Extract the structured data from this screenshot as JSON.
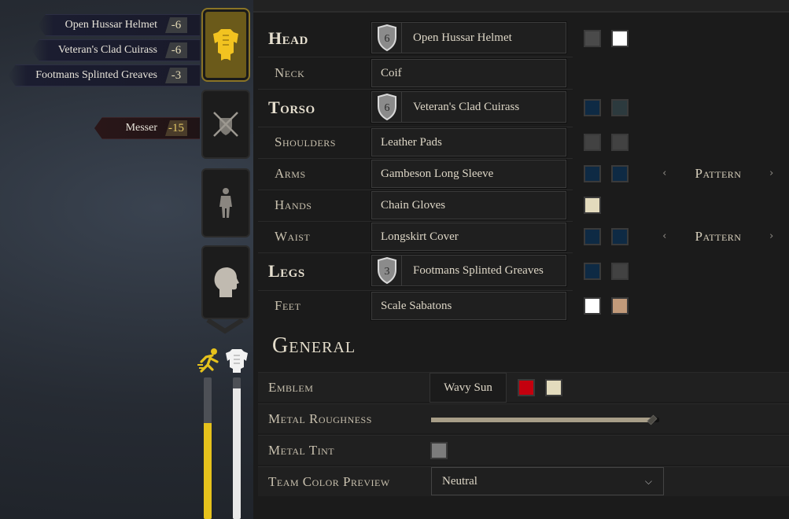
{
  "summary": {
    "items": [
      {
        "name": "Open Hussar Helmet",
        "cost": "-6"
      },
      {
        "name": "Veteran's Clad Cuirass",
        "cost": "-6"
      },
      {
        "name": "Footmans Splinted Greaves",
        "cost": "-3"
      }
    ],
    "weapon": {
      "name": "Messer",
      "cost": "-15"
    }
  },
  "tabs": [
    {
      "name": "armor-tab",
      "icon": "armor-icon",
      "active": true
    },
    {
      "name": "weapons-tab",
      "icon": "crossed-swords-shield-icon",
      "active": false
    },
    {
      "name": "body-tab",
      "icon": "body-figure-icon",
      "active": false
    },
    {
      "name": "head-tab",
      "icon": "head-profile-icon",
      "active": false
    }
  ],
  "stats": {
    "speed": {
      "icon": "running-man-icon",
      "level": 0.68,
      "color": "#e6c21c"
    },
    "armor": {
      "icon": "armor-white-icon",
      "level": 0.92,
      "color": "#e8e8e8"
    }
  },
  "slots": {
    "head": {
      "label": "Head",
      "item": "Open Hussar Helmet",
      "tier": "6",
      "colors": [
        "#4a4a4a",
        "#ffffff"
      ]
    },
    "neck": {
      "label": "Neck",
      "item": "Coif"
    },
    "torso": {
      "label": "Torso",
      "item": "Veteran's Clad Cuirass",
      "tier": "6",
      "colors": [
        "#0e2a44",
        "#2c3a3e"
      ]
    },
    "shoulders": {
      "label": "Shoulders",
      "item": "Leather Pads",
      "colors": [
        "#424242",
        "#424242"
      ]
    },
    "arms": {
      "label": "Arms",
      "item": "Gambeson Long Sleeve",
      "colors": [
        "#0e2a44",
        "#0e2a44"
      ],
      "pattern": "Pattern"
    },
    "hands": {
      "label": "Hands",
      "item": "Chain Gloves",
      "colors": [
        "#e3dbbd"
      ]
    },
    "waist": {
      "label": "Waist",
      "item": "Longskirt Cover",
      "colors": [
        "#0e2a44",
        "#0e2a44"
      ],
      "pattern": "Pattern"
    },
    "legs": {
      "label": "Legs",
      "item": "Footmans Splinted Greaves",
      "tier": "3",
      "colors": [
        "#0e2a44",
        "#424242"
      ]
    },
    "feet": {
      "label": "Feet",
      "item": "Scale Sabatons",
      "colors": [
        "#ffffff",
        "#c19a7a"
      ]
    }
  },
  "general": {
    "title": "General",
    "emblem": {
      "label": "Emblem",
      "value": "Wavy Sun",
      "colors": [
        "#c4000e",
        "#e3dbbd"
      ]
    },
    "roughness": {
      "label": "Metal Roughness",
      "level": 0.97
    },
    "tint": {
      "label": "Metal Tint",
      "color": "#7c7c7c"
    },
    "team_color": {
      "label": "Team Color Preview",
      "value": "Neutral"
    }
  }
}
